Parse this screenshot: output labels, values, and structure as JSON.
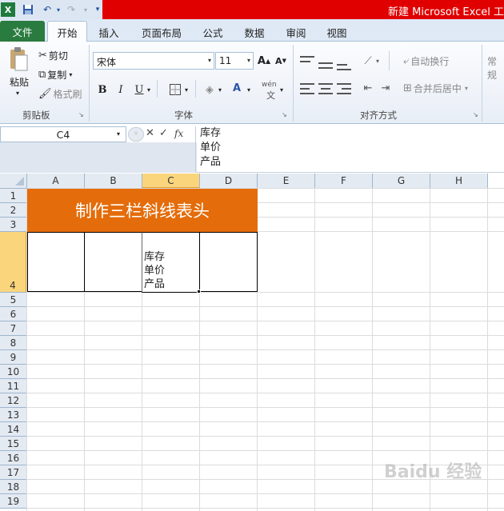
{
  "window": {
    "title": "新建 Microsoft Excel 工"
  },
  "quick_access": {
    "icons": [
      "excel-icon",
      "save-icon",
      "undo-icon",
      "redo-icon",
      "customize-icon"
    ]
  },
  "tabs": [
    {
      "label": "文件"
    },
    {
      "label": "开始"
    },
    {
      "label": "插入"
    },
    {
      "label": "页面布局"
    },
    {
      "label": "公式"
    },
    {
      "label": "数据"
    },
    {
      "label": "审阅"
    },
    {
      "label": "视图"
    }
  ],
  "ribbon": {
    "clipboard": {
      "paste": "粘贴",
      "cut": "剪切",
      "copy": "复制",
      "format_painter": "格式刷",
      "label": "剪贴板"
    },
    "font": {
      "name": "宋体",
      "size": "11",
      "label": "字体",
      "bold": "B",
      "italic": "I",
      "underline": "U",
      "grow": "A",
      "shrink": "A",
      "font_color": "A",
      "phonetic": "wén"
    },
    "alignment": {
      "wrap": "自动换行",
      "merge": "合并后居中",
      "label": "对齐方式"
    },
    "number": {
      "format": "常规"
    }
  },
  "formula_bar": {
    "cell_ref": "C4",
    "cancel": "✕",
    "enter": "✓",
    "fx": "fx",
    "content": "库存\n单价\n产品"
  },
  "sheet": {
    "columns": [
      "A",
      "B",
      "C",
      "D",
      "E",
      "F",
      "G",
      "H"
    ],
    "rows": [
      "1",
      "2",
      "3",
      "4",
      "5",
      "6",
      "7",
      "8",
      "9",
      "10",
      "11",
      "12",
      "13",
      "14",
      "15",
      "16",
      "17",
      "18",
      "19"
    ],
    "selected_column": "C",
    "selected_row": "4",
    "merged_title": "制作三栏斜线表头",
    "c4_text": "库存\n单价\n产品"
  },
  "colors": {
    "title_fill": "#e46c0a",
    "file_tab": "#2a7b3f",
    "title_bar": "#e00000",
    "selection_header": "#fbd57c"
  },
  "watermark": "Baidu 经验"
}
